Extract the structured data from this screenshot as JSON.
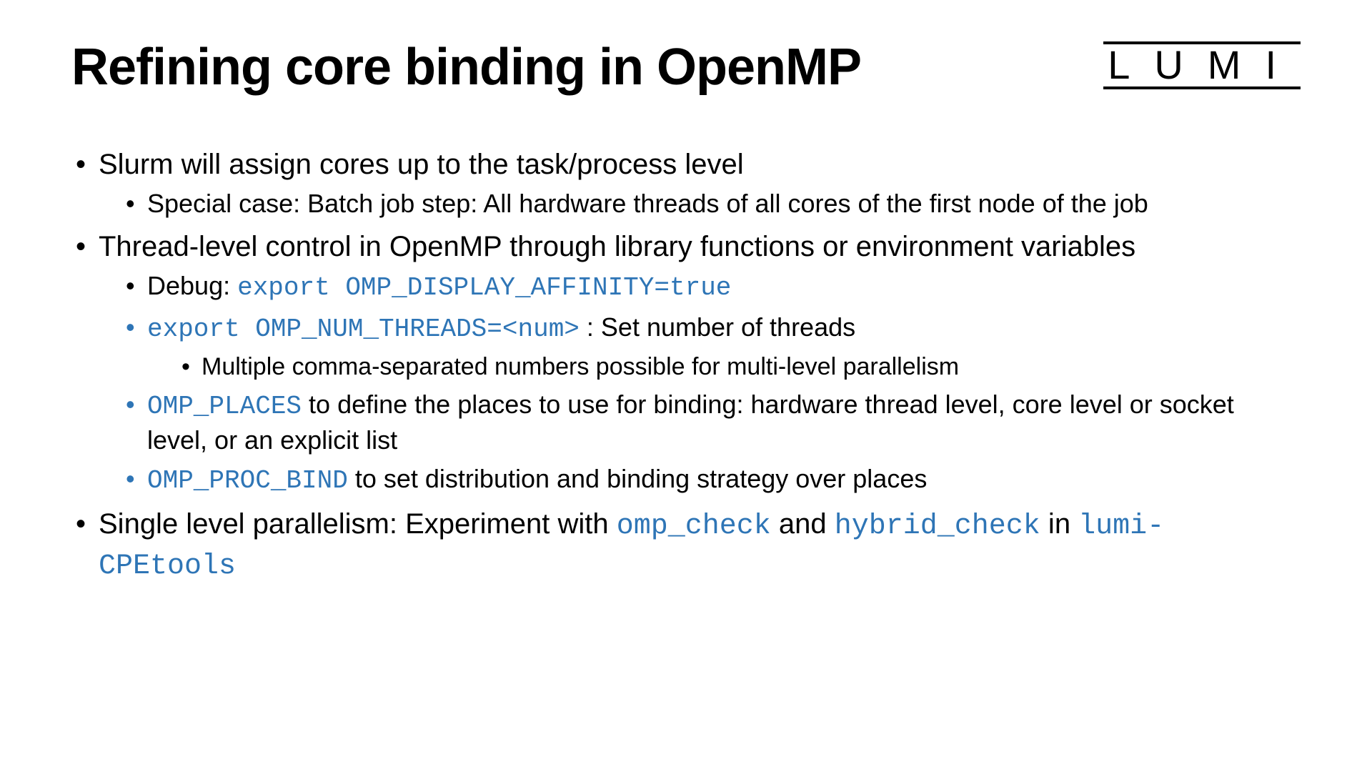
{
  "logo": "LUMI",
  "title": "Refining core binding in OpenMP",
  "b1": {
    "text": "Slurm will assign cores up to the task/process level",
    "sub1": "Special case: Batch job step: All hardware threads of all cores of the first node of the job"
  },
  "b2": {
    "text": "Thread-level control in OpenMP through library functions or environment variables",
    "sub1_prefix": "Debug: ",
    "sub1_code": "export OMP_DISPLAY_AFFINITY=true",
    "sub2_code": "export OMP_NUM_THREADS=<num>",
    "sub2_suffix": " : Set number of threads",
    "sub2_subsub": "Multiple comma-separated numbers possible for multi-level parallelism",
    "sub3_code": "OMP_PLACES",
    "sub3_suffix": " to define the places to use for binding: hardware thread level, core level or socket level, or an explicit list",
    "sub4_code": "OMP_PROC_BIND",
    "sub4_suffix": " to set distribution and binding strategy over places"
  },
  "b3": {
    "prefix": "Single level parallelism: Experiment with ",
    "code1": "omp_check",
    "mid": " and ",
    "code2": "hybrid_check",
    "mid2": " in ",
    "code3": "lumi-CPEtools"
  }
}
